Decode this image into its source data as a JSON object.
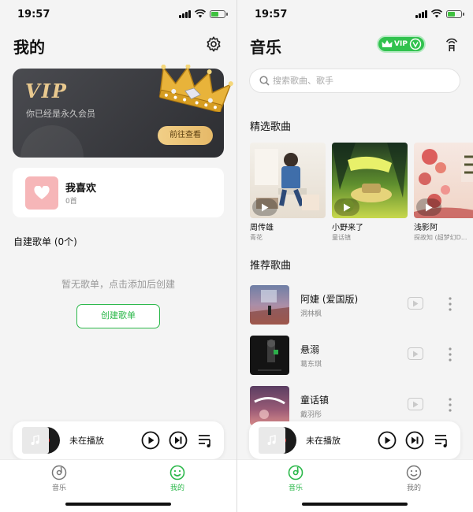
{
  "status": {
    "time": "19:57"
  },
  "mine": {
    "title": "我的",
    "vip": {
      "word": "VIP",
      "subtitle": "你已经是永久会员",
      "button": "前往查看"
    },
    "favorites": {
      "title": "我喜欢",
      "count": "0首"
    },
    "playlists": {
      "header": "自建歌单 (0个)",
      "empty": "暂无歌单，点击添加后创建",
      "create_button": "创建歌单"
    }
  },
  "music": {
    "title": "音乐",
    "vip_badge": "VIP",
    "search_placeholder": "搜索歌曲、歌手",
    "featured_title": "精选歌曲",
    "featured": [
      {
        "name": "周传雄",
        "artist": "青花"
      },
      {
        "name": "小野来了",
        "artist": "童话镇"
      },
      {
        "name": "浅影阿",
        "artist": "探故知 (超梦幻D..."
      }
    ],
    "recommended_title": "推荐歌曲",
    "recommended": [
      {
        "title": "阿婕 (爱国版)",
        "artist": "洞林枫"
      },
      {
        "title": "悬溺",
        "artist": "葛东琪"
      },
      {
        "title": "童话镇",
        "artist": "戴羽彤"
      }
    ]
  },
  "player": {
    "now_playing": "未在播放"
  },
  "tabs": {
    "music": "音乐",
    "mine": "我的"
  },
  "colors": {
    "accent": "#2bb84a",
    "vip_gold": "#e9c98f",
    "inactive_tab": "#777777"
  }
}
